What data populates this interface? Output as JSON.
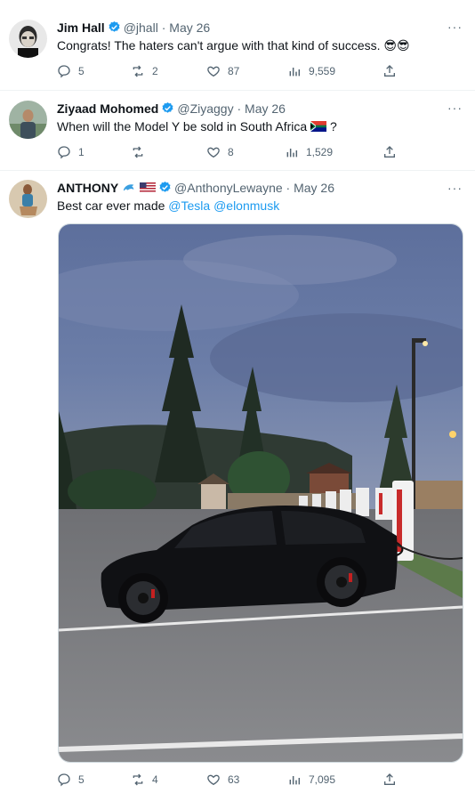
{
  "tweets": [
    {
      "name": "Jim Hall",
      "handle": "@jhall",
      "sep": "·",
      "date": "May 26",
      "text": "Congrats! The haters can't argue with that kind of success.",
      "emoji": "😎😎",
      "replies": "5",
      "retweets": "2",
      "likes": "87",
      "views": "9,559"
    },
    {
      "name": "Ziyaad Mohomed",
      "handle": "@Ziyaggy",
      "sep": "·",
      "date": "May 26",
      "text": "When will the Model Y be sold in South Africa",
      "text_suffix": "?",
      "replies": "1",
      "retweets": "",
      "likes": "8",
      "views": "1,529"
    },
    {
      "name": "ANTHONY",
      "handle": "@AnthonyLewayne",
      "sep": "·",
      "date": "May 26",
      "text": "Best car ever made",
      "mention1": "@Tesla",
      "mention2": "@elonmusk",
      "replies": "5",
      "retweets": "4",
      "likes": "63",
      "views": "7,095"
    }
  ],
  "more_label": "···",
  "colors": {
    "verified": "#1d9bf0",
    "link": "#1d9bf0",
    "muted": "#536471"
  }
}
